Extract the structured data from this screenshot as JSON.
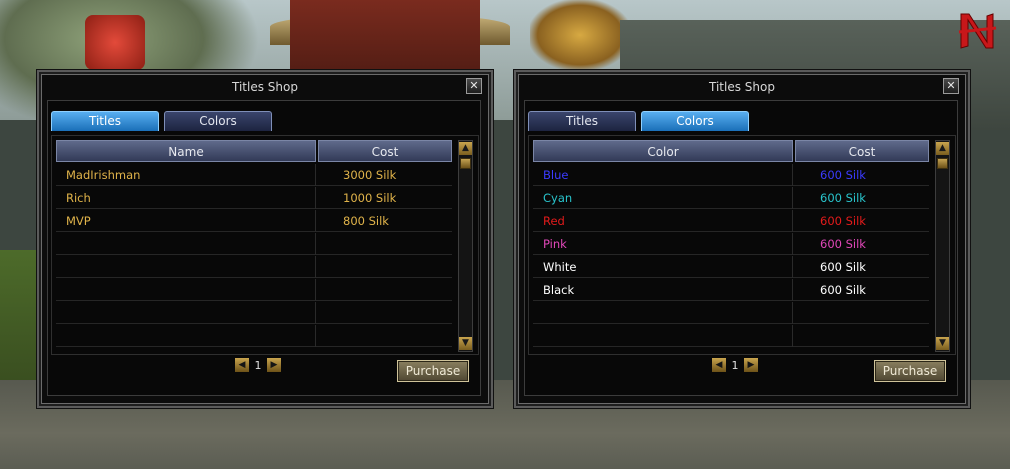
{
  "windows": [
    {
      "title": "Titles Shop",
      "close_glyph": "✕",
      "tabs": [
        {
          "label": "Titles",
          "active": true
        },
        {
          "label": "Colors",
          "active": false
        }
      ],
      "columns": [
        "Name",
        "Cost"
      ],
      "rows": [
        {
          "name": "MadIrishman",
          "cost": "3000 Silk",
          "color": "#e0b34a"
        },
        {
          "name": "Rich",
          "cost": "1000 Silk",
          "color": "#e0b34a"
        },
        {
          "name": "MVP",
          "cost": "800 Silk",
          "color": "#e0b34a"
        },
        {
          "name": "",
          "cost": ""
        },
        {
          "name": "",
          "cost": ""
        },
        {
          "name": "",
          "cost": ""
        },
        {
          "name": "",
          "cost": ""
        },
        {
          "name": "",
          "cost": ""
        }
      ],
      "page": "1",
      "purchase_label": "Purchase"
    },
    {
      "title": "Titles Shop",
      "close_glyph": "✕",
      "tabs": [
        {
          "label": "Titles",
          "active": false
        },
        {
          "label": "Colors",
          "active": true
        }
      ],
      "columns": [
        "Color",
        "Cost"
      ],
      "rows": [
        {
          "name": "Blue",
          "cost": "600 Silk",
          "color": "#3b3bff"
        },
        {
          "name": "Cyan",
          "cost": "600 Silk",
          "color": "#29c4cc"
        },
        {
          "name": "Red",
          "cost": "600 Silk",
          "color": "#e31b1b"
        },
        {
          "name": "Pink",
          "cost": "600 Silk",
          "color": "#e047b8"
        },
        {
          "name": "White",
          "cost": "600 Silk",
          "color": "#ffffff"
        },
        {
          "name": "Black",
          "cost": "600 Silk",
          "color": "#ffffff"
        },
        {
          "name": "",
          "cost": ""
        },
        {
          "name": "",
          "cost": ""
        }
      ],
      "page": "1",
      "purchase_label": "Purchase"
    }
  ],
  "icons": {
    "prev_page": "◀",
    "next_page": "▶",
    "scroll_up": "▲",
    "scroll_down": "▼"
  },
  "theme": {
    "active_tab": "#3a90e0",
    "header": "#4a5577",
    "button": "#6d6347"
  }
}
